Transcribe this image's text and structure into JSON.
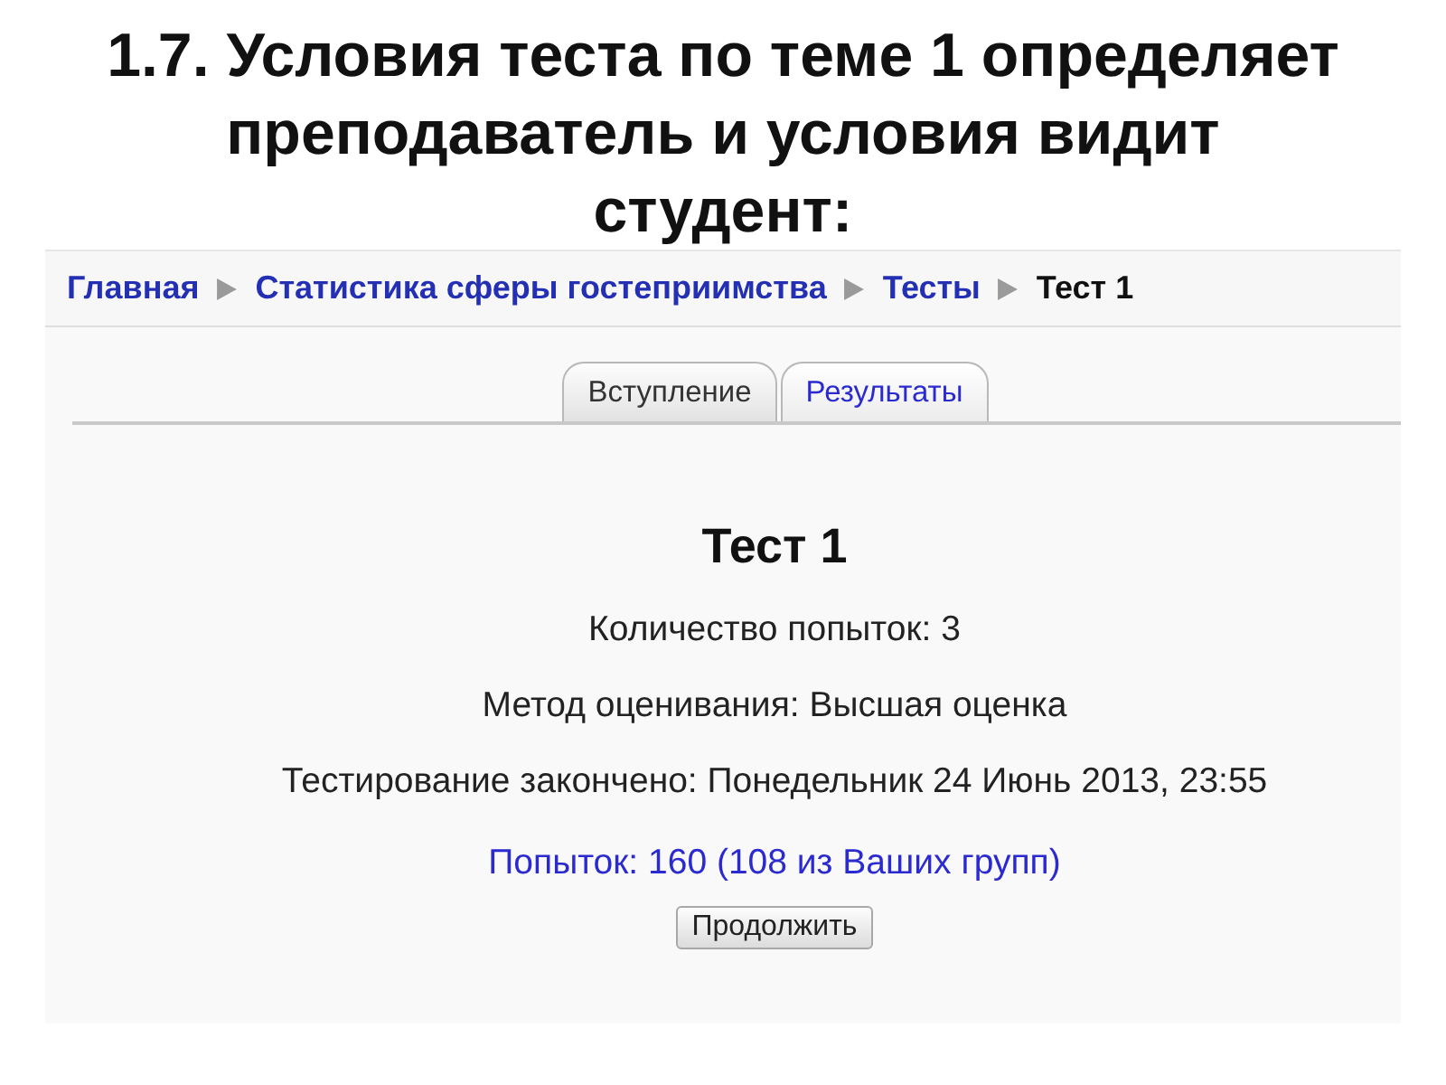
{
  "slide_title": "1.7. Условия теста по теме 1 определяет\nпреподаватель и условия видит\nстудент:",
  "breadcrumb": [
    {
      "label": "Главная",
      "kind": "link"
    },
    {
      "label": "Статистика сферы гостеприимства",
      "kind": "link"
    },
    {
      "label": "Тесты",
      "kind": "link"
    },
    {
      "label": "Тест 1",
      "kind": "current"
    }
  ],
  "tabs": [
    {
      "label": "Вступление",
      "selected": true
    },
    {
      "label": "Результаты",
      "selected": false
    }
  ],
  "quiz": {
    "title": "Тест 1",
    "details": [
      "Количество попыток: 3",
      "Метод оценивания: Высшая оценка",
      "Тестирование закончено: Понедельник 24 Июнь 2013, 23:55"
    ],
    "attempts_link": "Попыток: 160 (108 из Ваших групп)",
    "button": "Продолжить"
  }
}
